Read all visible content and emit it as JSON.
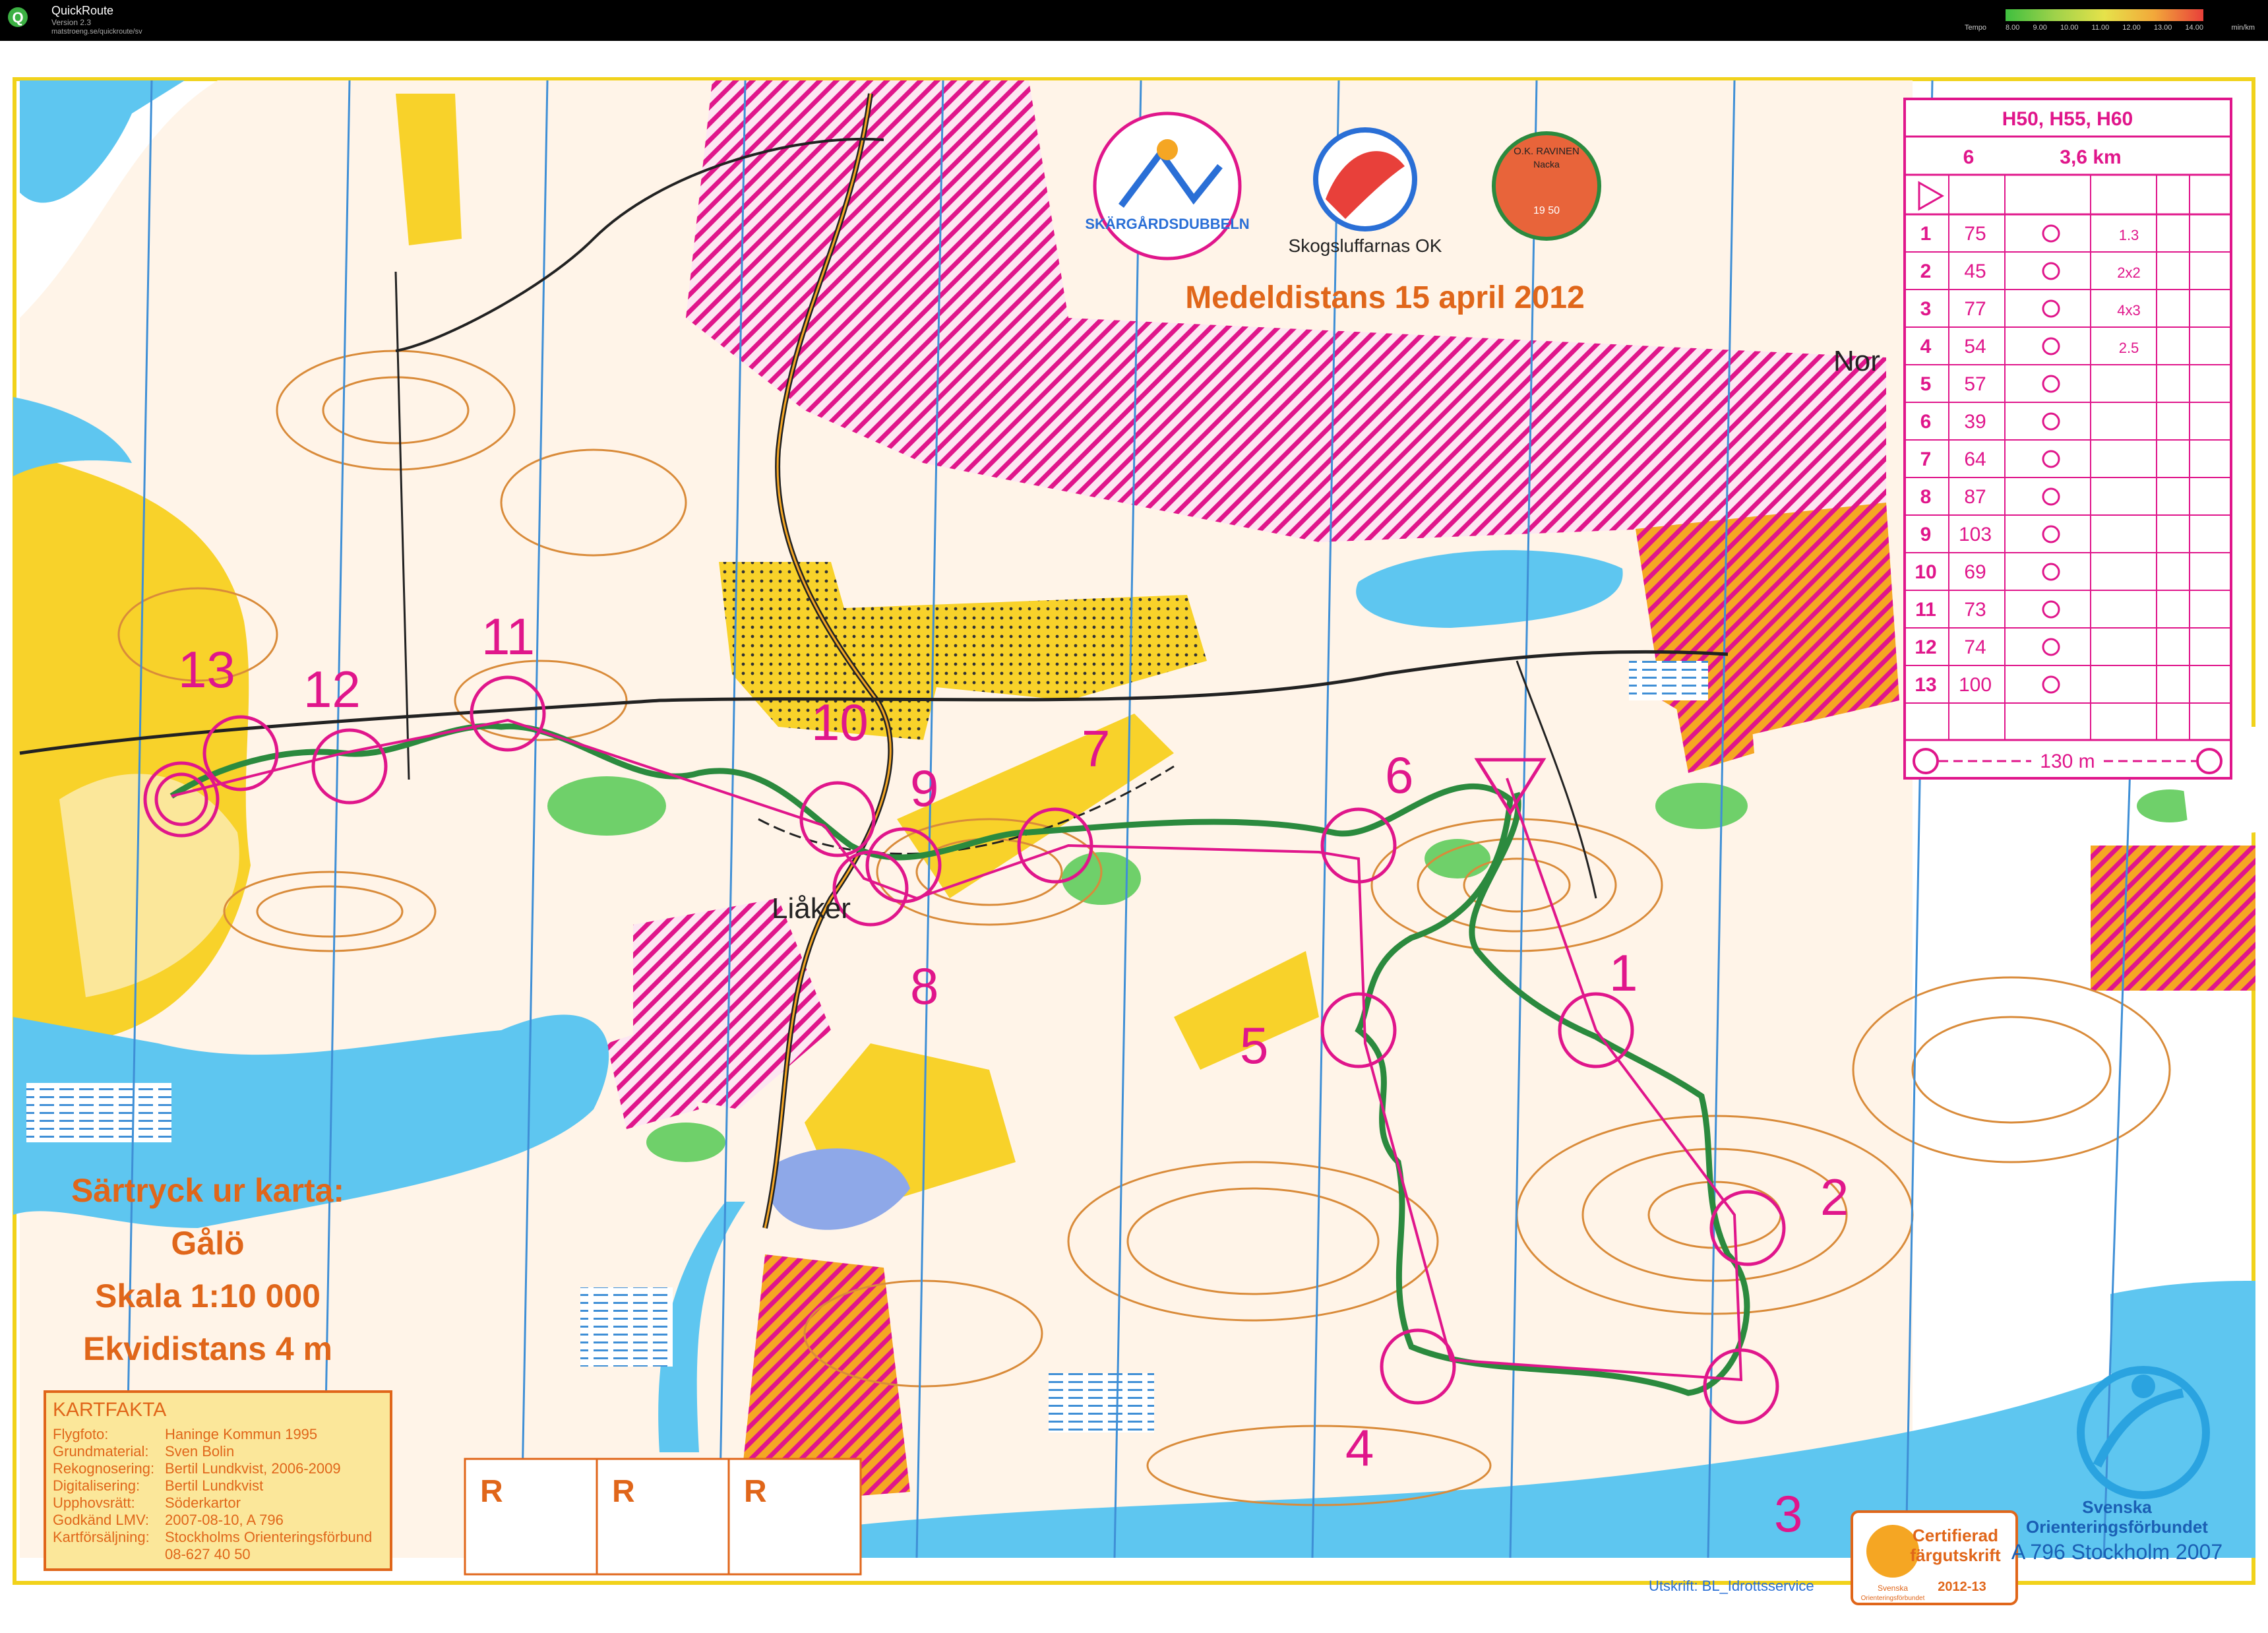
{
  "app": {
    "title": "QuickRoute",
    "version": "Version 2.3",
    "url": "matstroeng.se/quickroute/sv",
    "icon": "quickroute-q-icon"
  },
  "tempo_legend": {
    "label": "Tempo",
    "ticks": [
      "8.00",
      "9.00",
      "10.00",
      "11.00",
      "12.00",
      "13.00",
      "14.00"
    ],
    "unit": "min/km",
    "colors": [
      "#3fbf3f",
      "#9fd24a",
      "#e6e24a",
      "#f2a83a",
      "#e8403a"
    ]
  },
  "event": {
    "title": "Medeldistans 15 april 2012",
    "organizer": "Skogsluffarnas OK",
    "logos": [
      "skargardsdubbeln-logo",
      "skogsluffarnas-ok-logo",
      "ok-ravinen-logo"
    ],
    "logo_texts": [
      "SKÄRGÅRDSDUBBELN",
      "O.K. RAVINEN",
      "Nacka",
      "19 50"
    ]
  },
  "map_info": {
    "line1": "Särtryck ur karta:",
    "line2": "Gålö",
    "line3": "Skala 1:10 000",
    "line4": "Ekvidistans 4 m"
  },
  "kartfakta": {
    "title": "KARTFAKTA",
    "rows": [
      {
        "k": "Flygfoto:",
        "v": "Haninge Kommun 1995"
      },
      {
        "k": "Grundmaterial:",
        "v": "Sven Bolin"
      },
      {
        "k": "Rekognosering:",
        "v": "Bertil Lundkvist, 2006-2009"
      },
      {
        "k": "Digitalisering:",
        "v": "Bertil Lundkvist"
      },
      {
        "k": "Upphovsrätt:",
        "v": "Söderkartor"
      },
      {
        "k": "Godkänd LMV:",
        "v": "2007-08-10, A 796"
      },
      {
        "k": "Kartförsäljning:",
        "v": "Stockholms Orienteringsförbund"
      },
      {
        "k": "",
        "v": "08-627 40 50"
      }
    ]
  },
  "r_boxes": [
    "R",
    "R",
    "R"
  ],
  "place_names": [
    "Liåker",
    "Nor"
  ],
  "print_note": "Utskrift: BL_Idrottsservice",
  "certified": {
    "line1": "Certifierad",
    "line2": "färgutskrift",
    "line3": "2012-13",
    "small1": "Svenska",
    "small2": "Orienteringsförbundet"
  },
  "sofd": {
    "line1": "Svenska",
    "line2": "Orienteringsförbundet",
    "line3": "A 796 Stockholm 2007"
  },
  "control_description": {
    "classes": "H50, H55, H60",
    "course": "6",
    "length": "3,6 km",
    "controls": [
      {
        "n": "1",
        "code": "75",
        "size": "1.3"
      },
      {
        "n": "2",
        "code": "45",
        "size": "2x2"
      },
      {
        "n": "3",
        "code": "77",
        "size": "4x3"
      },
      {
        "n": "4",
        "code": "54",
        "size": "2.5"
      },
      {
        "n": "5",
        "code": "57",
        "size": ""
      },
      {
        "n": "6",
        "code": "39",
        "size": ""
      },
      {
        "n": "7",
        "code": "64",
        "size": ""
      },
      {
        "n": "8",
        "code": "87",
        "size": ""
      },
      {
        "n": "9",
        "code": "103",
        "size": ""
      },
      {
        "n": "10",
        "code": "69",
        "size": ""
      },
      {
        "n": "11",
        "code": "73",
        "size": ""
      },
      {
        "n": "12",
        "code": "74",
        "size": ""
      },
      {
        "n": "13",
        "code": "100",
        "size": ""
      }
    ],
    "finish": "130 m"
  },
  "control_labels": [
    "1",
    "2",
    "3",
    "4",
    "5",
    "6",
    "7",
    "8",
    "9",
    "10",
    "11",
    "12",
    "13"
  ]
}
